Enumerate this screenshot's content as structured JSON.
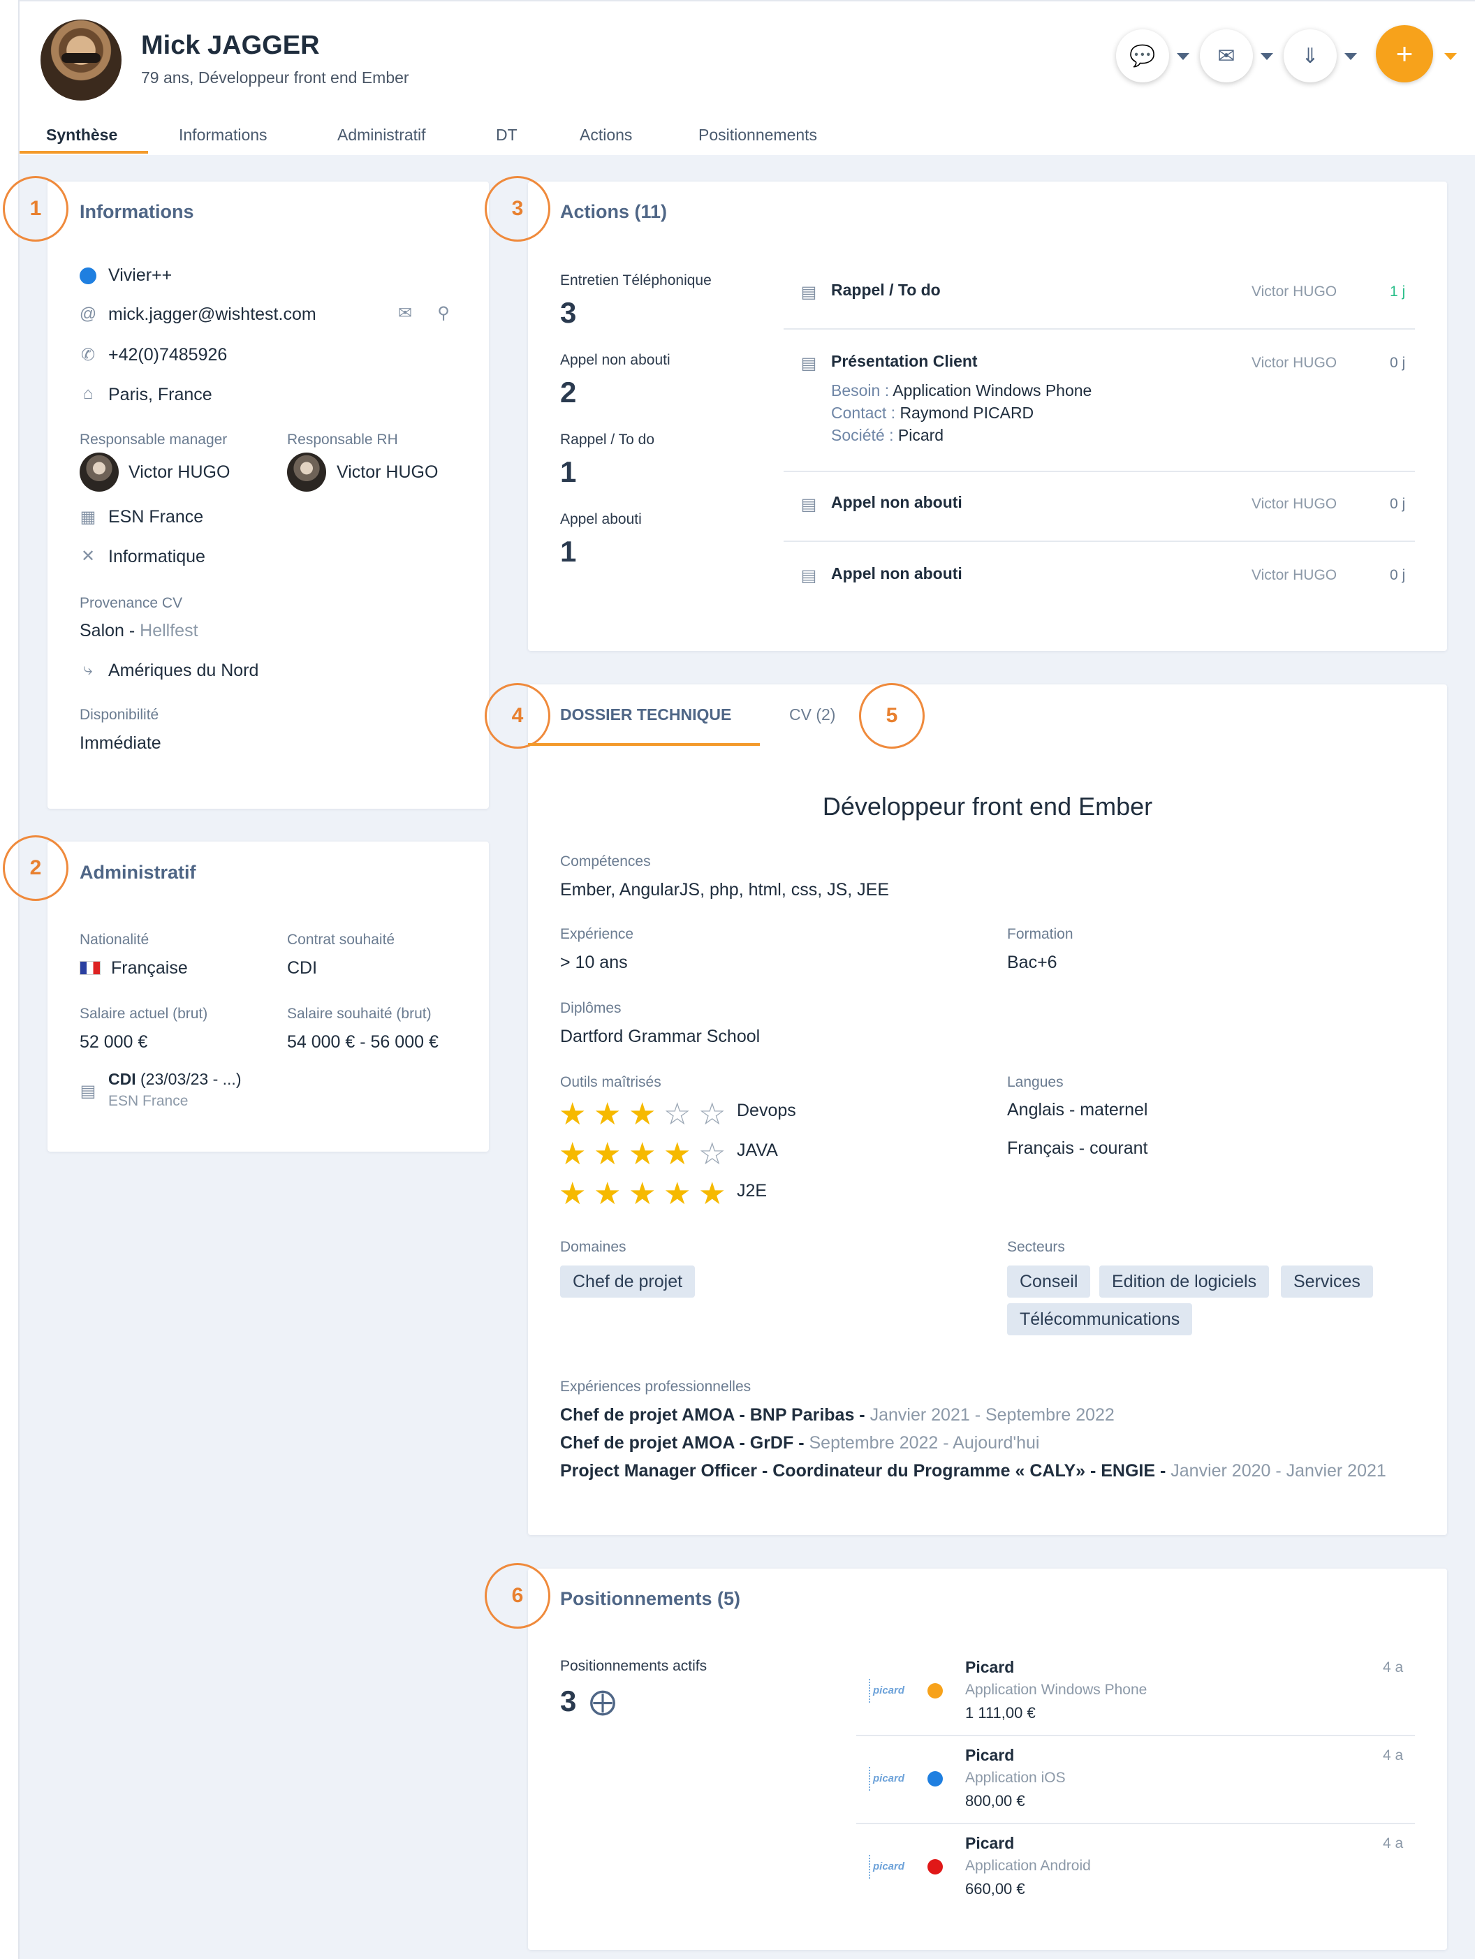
{
  "header": {
    "name": "Mick JAGGER",
    "subtitle": "79 ans, Développeur front end Ember",
    "tabs": [
      {
        "label": "Synthèse"
      },
      {
        "label": "Informations"
      },
      {
        "label": "Administratif"
      },
      {
        "label": "DT"
      },
      {
        "label": "Actions"
      },
      {
        "label": "Positionnements"
      }
    ],
    "plus_label": "+"
  },
  "badges": [
    "1",
    "2",
    "3",
    "4",
    "5",
    "6"
  ],
  "informations": {
    "title": "Informations",
    "agency": "Vivier++",
    "email": "mick.jagger@wishtest.com",
    "phone": "+42(0)7485926",
    "location": "Paris, France",
    "manager_label": "Responsable manager",
    "manager_name": "Victor HUGO",
    "rh_label": "Responsable RH",
    "rh_name": "Victor HUGO",
    "company": "ESN France",
    "sector": "Informatique",
    "provenance_label": "Provenance CV",
    "provenance_main": "Salon - ",
    "provenance_detail": "Hellfest",
    "mobility": "Amériques du Nord",
    "disponibilite_label": "Disponibilité",
    "disponibilite_value": "Immédiate"
  },
  "administratif": {
    "title": "Administratif",
    "nationalite_label": "Nationalité",
    "nationalite_value": "Française",
    "contrat_label": "Contrat souhaité",
    "contrat_value": "CDI",
    "salaire_actuel_label": "Salaire actuel (brut)",
    "salaire_actuel_value": "52 000 €",
    "salaire_souhaite_label": "Salaire souhaité (brut)",
    "salaire_souhaite_value": "54 000 € - 56 000 €",
    "contract_title": "CDI",
    "contract_dates": " (23/03/23 - ...)",
    "contract_company": "ESN France"
  },
  "actions": {
    "title": "Actions (11)",
    "stats": [
      {
        "label": "Entretien Téléphonique",
        "value": "3"
      },
      {
        "label": "Appel non abouti",
        "value": "2"
      },
      {
        "label": "Rappel / To do",
        "value": "1"
      },
      {
        "label": "Appel abouti",
        "value": "1"
      }
    ],
    "list": [
      {
        "title": "Rappel / To do",
        "author": "Victor HUGO",
        "age": "1 j",
        "age_color": "#2bbf8a"
      },
      {
        "title": "Présentation Client",
        "author": "Victor HUGO",
        "age": "0 j",
        "besoin_label": "Besoin : ",
        "besoin_value": "Application Windows Phone",
        "contact_label": "Contact : ",
        "contact_value": "Raymond PICARD",
        "societe_label": "Société : ",
        "societe_value": "Picard"
      },
      {
        "title": "Appel non abouti",
        "author": "Victor HUGO",
        "age": "0 j"
      },
      {
        "title": "Appel non abouti",
        "author": "Victor HUGO",
        "age": "0 j"
      }
    ]
  },
  "dossier": {
    "tab_dt": "DOSSIER TECHNIQUE",
    "tab_cv": "CV (2)",
    "headline": "Développeur front end Ember",
    "competences_label": "Compétences",
    "competences_value": "Ember, AngularJS, php, html, css, JS, JEE",
    "experience_label": "Expérience",
    "experience_value": "> 10 ans",
    "formation_label": "Formation",
    "formation_value": "Bac+6",
    "diplomes_label": "Diplômes",
    "diplomes_value": "Dartford Grammar School",
    "outils_label": "Outils maîtrisés",
    "outils": [
      {
        "name": "Devops",
        "rating": 3,
        "max": 5
      },
      {
        "name": "JAVA",
        "rating": 4,
        "max": 5
      },
      {
        "name": "J2E",
        "rating": 5,
        "max": 5
      }
    ],
    "langues_label": "Langues",
    "langues": [
      "Anglais - maternel",
      "Français - courant"
    ],
    "domaines_label": "Domaines",
    "domaines": [
      "Chef de projet"
    ],
    "secteurs_label": "Secteurs",
    "secteurs": [
      "Conseil",
      "Edition de logiciels",
      "Services",
      "Télécommunications"
    ],
    "experiences_label": "Expériences professionnelles",
    "experiences": [
      {
        "main": "Chef de projet AMOA - BNP Paribas - ",
        "dates": "Janvier 2021 - Septembre 2022"
      },
      {
        "main": "Chef de projet AMOA - GrDF - ",
        "dates": "Septembre 2022 - Aujourd'hui"
      },
      {
        "main": "Project Manager Officer - Coordinateur du Programme « CALY» - ENGIE - ",
        "dates": "Janvier 2020 - Janvier 2021"
      }
    ]
  },
  "positionnements": {
    "title": "Positionnements (5)",
    "active_label": "Positionnements actifs",
    "active_value": "3",
    "items": [
      {
        "logo": "picard",
        "company": "Picard",
        "project": "Application Windows Phone",
        "amount": "1 111,00 €",
        "age": "4 a",
        "status_color": "#f7a21b"
      },
      {
        "logo": "picard",
        "company": "Picard",
        "project": "Application iOS",
        "amount": "800,00 €",
        "age": "4 a",
        "status_color": "#1f7fe0"
      },
      {
        "logo": "picard",
        "company": "Picard",
        "project": "Application Android",
        "amount": "660,00 €",
        "age": "4 a",
        "status_color": "#e01818"
      }
    ]
  }
}
